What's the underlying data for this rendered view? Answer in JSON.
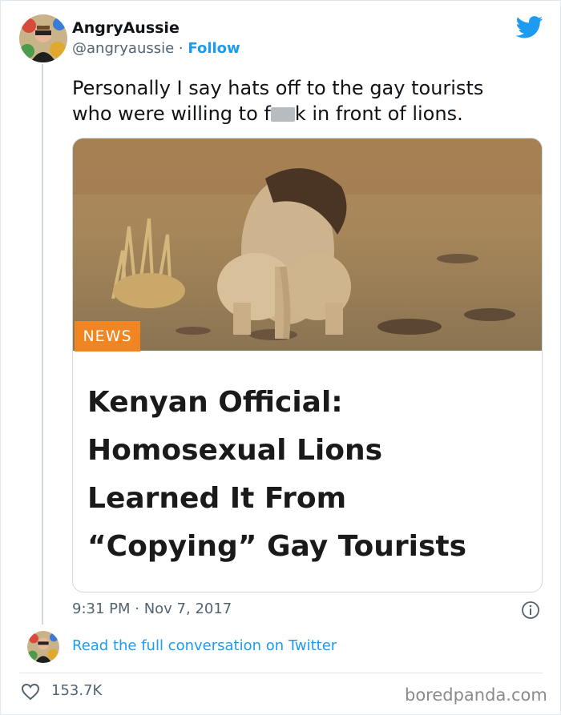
{
  "tweet": {
    "author_name": "AngryAussie",
    "handle": "@angryaussie",
    "separator": "·",
    "follow_label": "Follow",
    "text_part1": "Personally I say hats off to the gay tourists who were willing to f",
    "text_part2": "k in front of lions.",
    "timestamp": "9:31 PM · Nov 7, 2017",
    "likes": "153.7K"
  },
  "card": {
    "badge": "NEWS",
    "headline": [
      "Kenyan Official:",
      "Homosexual Lions",
      "Learned It From",
      "“Copying” Gay Tourists"
    ]
  },
  "footer": {
    "read_link": "Read the full conversation on Twitter",
    "watermark": "boredpanda.com"
  },
  "colors": {
    "accent": "#1d9bf0",
    "badge": "#f08522",
    "muted": "#536471"
  },
  "icons": {
    "brand": "twitter-bird-icon",
    "info": "info-icon",
    "like": "heart-icon"
  }
}
